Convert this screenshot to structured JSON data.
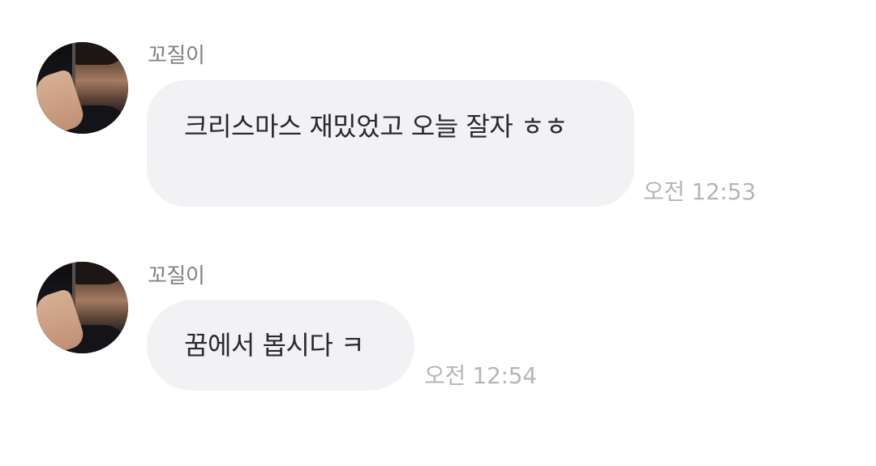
{
  "messages": [
    {
      "sender": "꼬질이",
      "text": "크리스마스 재밌었고 오늘 잘자 ㅎㅎ",
      "time": "오전 12:53"
    },
    {
      "sender": "꼬질이",
      "text": "꿈에서 봅시다 ㅋ",
      "time": "오전 12:54"
    }
  ],
  "colors": {
    "bubble_bg": "#f2f2f4",
    "sender_name": "#808085",
    "timestamp": "#b6b6ba",
    "message_text": "#2a2a2e"
  }
}
